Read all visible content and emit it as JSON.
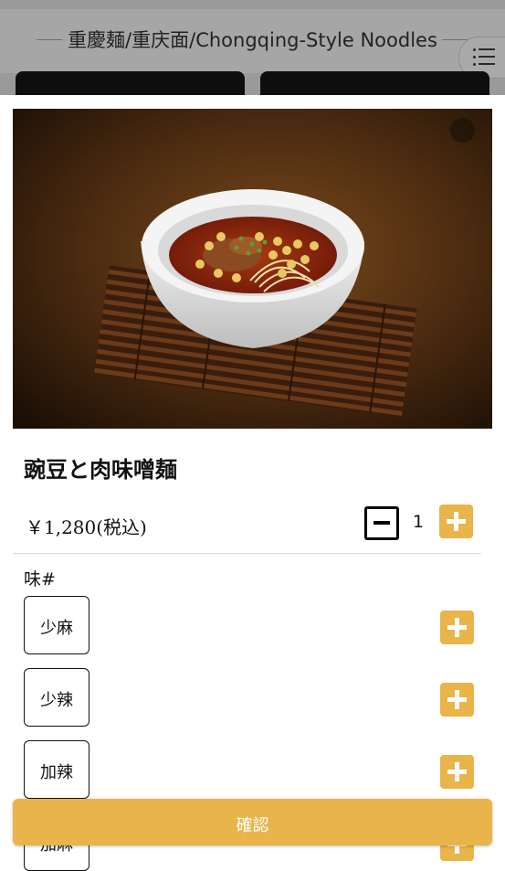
{
  "background_page": {
    "title": "重慶麺/重庆面/Chongqing-Style Noodles",
    "menu_icon": "list-icon"
  },
  "item": {
    "name": "豌豆と肉味噌麺",
    "price": "￥1,280(税込)",
    "quantity": "1",
    "photo_alt": "noodle-bowl-photo"
  },
  "options": {
    "section_label": "味#",
    "items": [
      {
        "label": "少麻"
      },
      {
        "label": "少辣"
      },
      {
        "label": "加辣"
      },
      {
        "label": "加麻"
      }
    ]
  },
  "actions": {
    "confirm_label": "確認"
  },
  "colors": {
    "accent": "#e9b44a",
    "text": "#111111"
  }
}
